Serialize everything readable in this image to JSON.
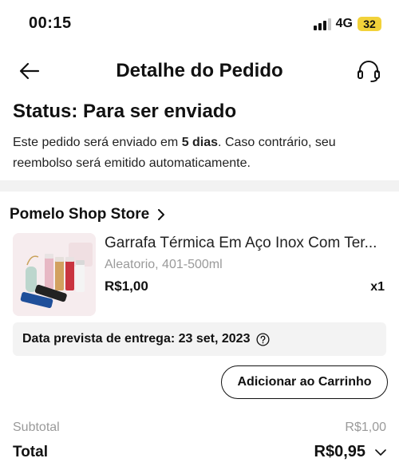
{
  "statusbar": {
    "time": "00:15",
    "network": "4G",
    "battery": "32"
  },
  "header": {
    "title": "Detalhe do Pedido"
  },
  "order_status": {
    "title": "Status: Para ser enviado",
    "desc_prefix": "Este pedido será enviado em ",
    "desc_bold": "5 dias",
    "desc_suffix": ". Caso contrário, seu reembolso será emitido automaticamente."
  },
  "store": {
    "name": "Pomelo Shop Store"
  },
  "product": {
    "name": "Garrafa Térmica Em Aço Inox Com Ter...",
    "variant": "Aleatorio, 401-500ml",
    "price": "R$1,00",
    "quantity": "x1"
  },
  "delivery": {
    "text": "Data prevista de entrega: 23 set, 2023"
  },
  "actions": {
    "add_to_cart": "Adicionar ao Carrinho"
  },
  "summary": {
    "subtotal_label": "Subtotal",
    "subtotal_value": "R$1,00",
    "total_label": "Total",
    "total_value": "R$0,95"
  },
  "colors": {
    "battery": "#f2d23a",
    "band": "#f2f2f2",
    "muted": "#9a9a9a"
  }
}
